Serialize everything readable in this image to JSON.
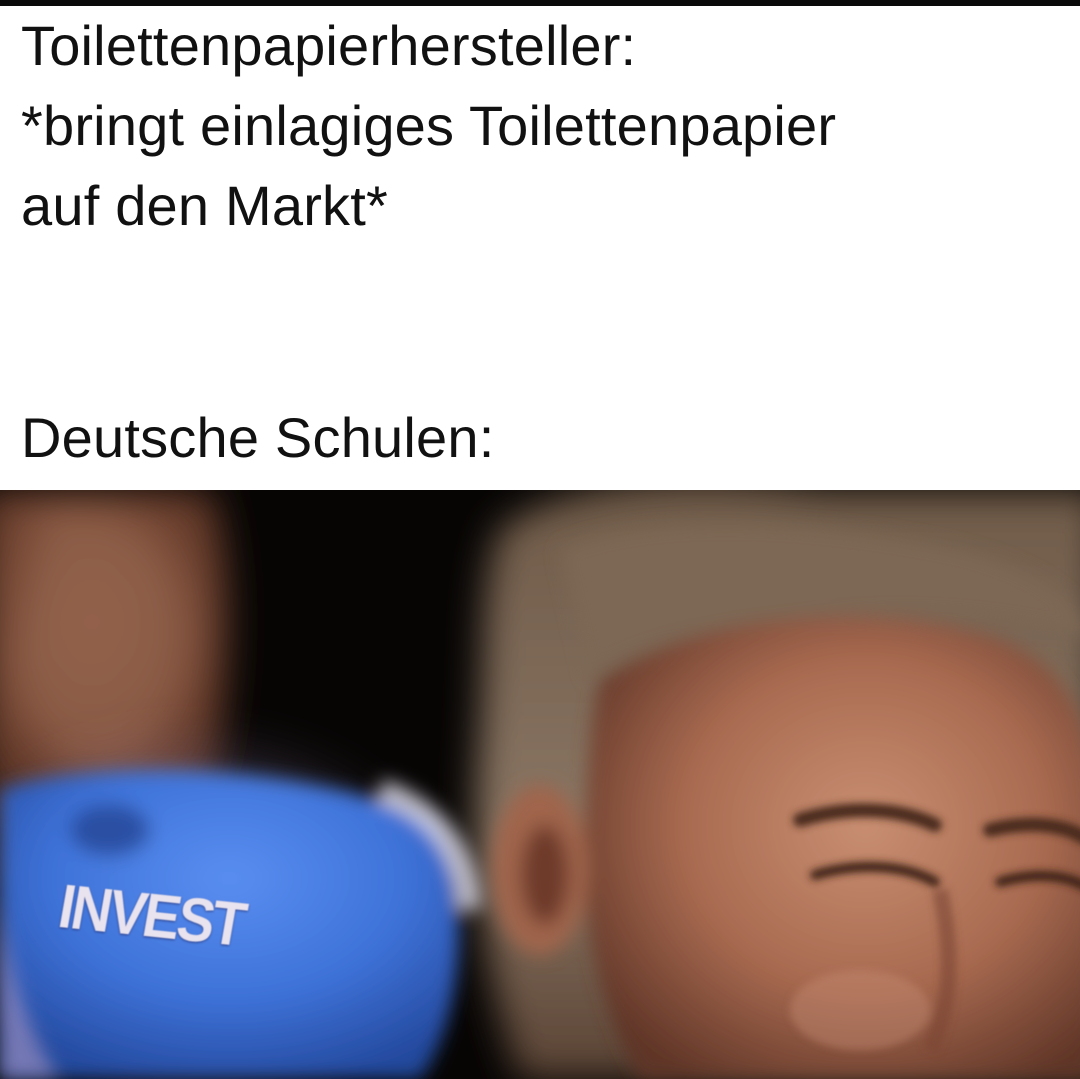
{
  "caption": {
    "line1": "Toilettenpapierhersteller:",
    "line2": "*bringt einlagiges Toilettenpapier",
    "line3": "auf den Markt*",
    "line4": "Deutsche Schulen:"
  },
  "button": {
    "label": "INVEST",
    "color": "#3e72d8"
  }
}
